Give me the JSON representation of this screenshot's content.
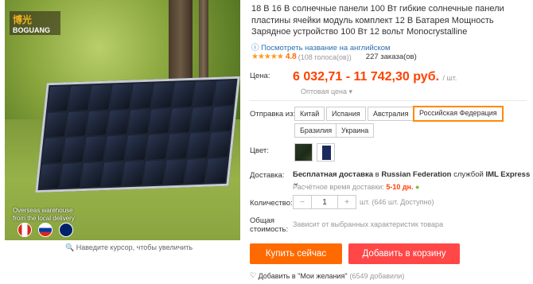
{
  "logo": {
    "brand_cn": "博光",
    "brand": "BOGUANG"
  },
  "gallery": {
    "warehouse_line1": "Overseas warehouse",
    "warehouse_line2": "from the local delivery",
    "hint": "Наведите курсор, чтобы увеличить"
  },
  "product": {
    "title": "18 В 16 В солнечные панели 100 Вт гибкие солнечные панели пластины ячейки модуль комплект 12 В Батарея Мощность Зарядное устройство 100 Вт 12 вольт Monocrystalline",
    "translate_link": "Посмотреть название на английском",
    "stars": "★★★★★",
    "rating": "4.8",
    "votes": "(108 голоса(ов))",
    "orders": "227 заказа(ов)"
  },
  "price": {
    "label": "Цена:",
    "value": "6 032,71 - 11 742,30 руб.",
    "unit": "/ шт.",
    "wholesale": "Оптовая цена ▾"
  },
  "shipping_from": {
    "label": "Отправка из:",
    "options": [
      "Китай",
      "Испания",
      "Австралия",
      "Российская Федерация",
      "Бразилия",
      "Украина"
    ],
    "selected": "Российская Федерация"
  },
  "color": {
    "label": "Цвет:"
  },
  "delivery": {
    "label": "Доставка:",
    "free": "Бесплатная доставка",
    "in": "в",
    "dest": "Russian Federation",
    "by": "службой",
    "carrier": "IML Express",
    "est_label": "Расчётное время доставки:",
    "days": "5-10",
    "days_unit": "дн."
  },
  "quantity": {
    "label": "Количество:",
    "minus": "−",
    "value": "1",
    "plus": "+",
    "available": "шт. (646 шт. Доступно)"
  },
  "total": {
    "label_1": "Общая",
    "label_2": "стоимость:",
    "note": "Зависит от выбранных характеристик товара"
  },
  "actions": {
    "buy": "Купить сейчас",
    "cart": "Добавить в корзину"
  },
  "wishlist": {
    "label": "Добавить в \"Мои желания\"",
    "count": "(6549 добавили)"
  },
  "colors": {
    "accent_orange": "#ff6a00",
    "price_red": "#ff4200",
    "cart_red": "#ff4747",
    "link_blue": "#2a6fb2"
  }
}
